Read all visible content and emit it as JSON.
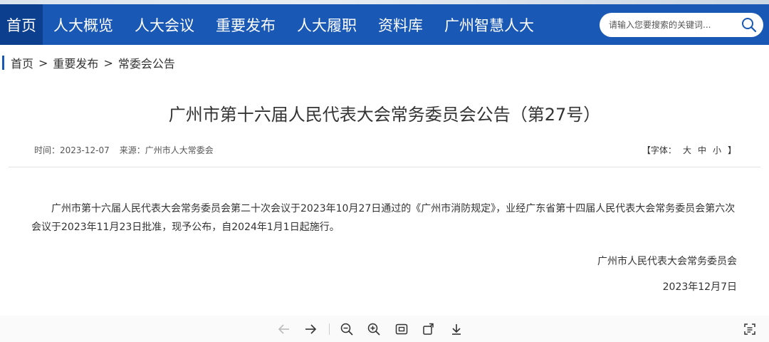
{
  "nav": {
    "items": [
      {
        "label": "首页",
        "active": true
      },
      {
        "label": "人大概览"
      },
      {
        "label": "人大会议"
      },
      {
        "label": "重要发布"
      },
      {
        "label": "人大履职"
      },
      {
        "label": "资料库"
      },
      {
        "label": "广州智慧人大"
      }
    ],
    "search_placeholder": "请输入您要搜索的关键词..."
  },
  "breadcrumb": {
    "items": [
      "首页",
      "重要发布",
      "常委会公告"
    ],
    "separator": ">"
  },
  "article": {
    "title": "广州市第十六届人民代表大会常务委员会公告（第27号）",
    "time_label": "时间：",
    "time": "2023-12-07",
    "source_label": "来源：",
    "source": "广州市人大常委会",
    "font_size_open": "【字体：",
    "font_size_options": [
      "大",
      "中",
      "小"
    ],
    "font_size_close": "】",
    "body": "广州市第十六届人民代表大会常务委员会第二十次会议于2023年10月27日通过的《广州市消防规定》，业经广东省第十四届人民代表大会常务委员会第六次会议于2023年11月23日批准，现予公布，自2024年1月1日起施行。",
    "signature_org": "广州市人民代表大会常务委员会",
    "signature_date": "2023年12月7日"
  },
  "toolbar": {
    "icons": [
      "arrow-left-icon",
      "arrow-right-icon",
      "zoom-out-icon",
      "zoom-in-icon",
      "fit-screen-icon",
      "rotate-icon",
      "download-icon",
      "scan-icon"
    ]
  },
  "colors": {
    "nav_bg": "#1a58b5",
    "nav_active_bg": "#0d3f8f",
    "page_bg": "#f2f2f2"
  }
}
